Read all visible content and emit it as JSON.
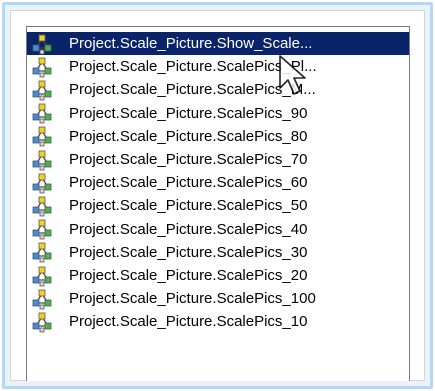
{
  "list": {
    "items": [
      {
        "label": "Project.Scale_Picture.Show_Scale...",
        "icon": "object-tree-icon",
        "selected": true
      },
      {
        "label": "Project.Scale_Picture.ScalePics_Pl...",
        "icon": "object-tree-icon",
        "selected": false
      },
      {
        "label": "Project.Scale_Picture.ScalePics_M...",
        "icon": "object-tree-icon",
        "selected": false
      },
      {
        "label": "Project.Scale_Picture.ScalePics_90",
        "icon": "object-tree-icon",
        "selected": false
      },
      {
        "label": "Project.Scale_Picture.ScalePics_80",
        "icon": "object-tree-icon",
        "selected": false
      },
      {
        "label": "Project.Scale_Picture.ScalePics_70",
        "icon": "object-tree-icon",
        "selected": false
      },
      {
        "label": "Project.Scale_Picture.ScalePics_60",
        "icon": "object-tree-icon",
        "selected": false
      },
      {
        "label": "Project.Scale_Picture.ScalePics_50",
        "icon": "object-tree-icon",
        "selected": false
      },
      {
        "label": "Project.Scale_Picture.ScalePics_40",
        "icon": "object-tree-icon",
        "selected": false
      },
      {
        "label": "Project.Scale_Picture.ScalePics_30",
        "icon": "object-tree-icon",
        "selected": false
      },
      {
        "label": "Project.Scale_Picture.ScalePics_20",
        "icon": "object-tree-icon",
        "selected": false
      },
      {
        "label": "Project.Scale_Picture.ScalePics_100",
        "icon": "object-tree-icon",
        "selected": false
      },
      {
        "label": "Project.Scale_Picture.ScalePics_10",
        "icon": "object-tree-icon",
        "selected": false
      }
    ]
  },
  "colors": {
    "selection": "#0a246a",
    "selection_text": "#ffffff",
    "text": "#000000",
    "focus_glow": "#b6d6f5"
  },
  "cursor": {
    "icon": "mouse-pointer-icon"
  }
}
